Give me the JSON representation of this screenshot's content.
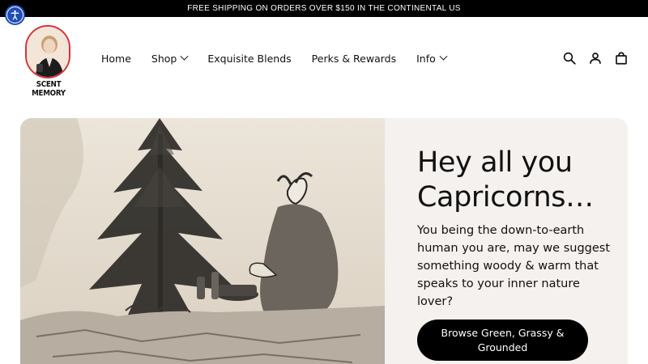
{
  "announcement": {
    "text": "FREE SHIPPING ON ORDERS OVER $150 IN THE CONTINENTAL US"
  },
  "accessibility": {
    "icon": "accessibility-icon"
  },
  "brand": {
    "name": "SCENT MEMORY"
  },
  "nav": {
    "items": [
      {
        "label": "Home",
        "dropdown": false
      },
      {
        "label": "Shop",
        "dropdown": true
      },
      {
        "label": "Exquisite Blends",
        "dropdown": false
      },
      {
        "label": "Perks & Rewards",
        "dropdown": false
      },
      {
        "label": "Info",
        "dropdown": true
      }
    ]
  },
  "header_icons": [
    "search-icon",
    "account-icon",
    "cart-icon"
  ],
  "hero": {
    "title_line1": "Hey all you",
    "title_line2": "Capricorns…",
    "body": "You being the down-to-earth human you are, may we suggest something woody & warm that speaks to your inner nature lover?",
    "button_label": "Browse Green, Grassy & Grounded"
  },
  "colors": {
    "announcement_bg": "#000000",
    "hero_panel_bg": "#f4f1ee",
    "button_bg": "#000000",
    "accessibility_blue": "#1e4db7",
    "logo_ring": "#d8323a"
  }
}
